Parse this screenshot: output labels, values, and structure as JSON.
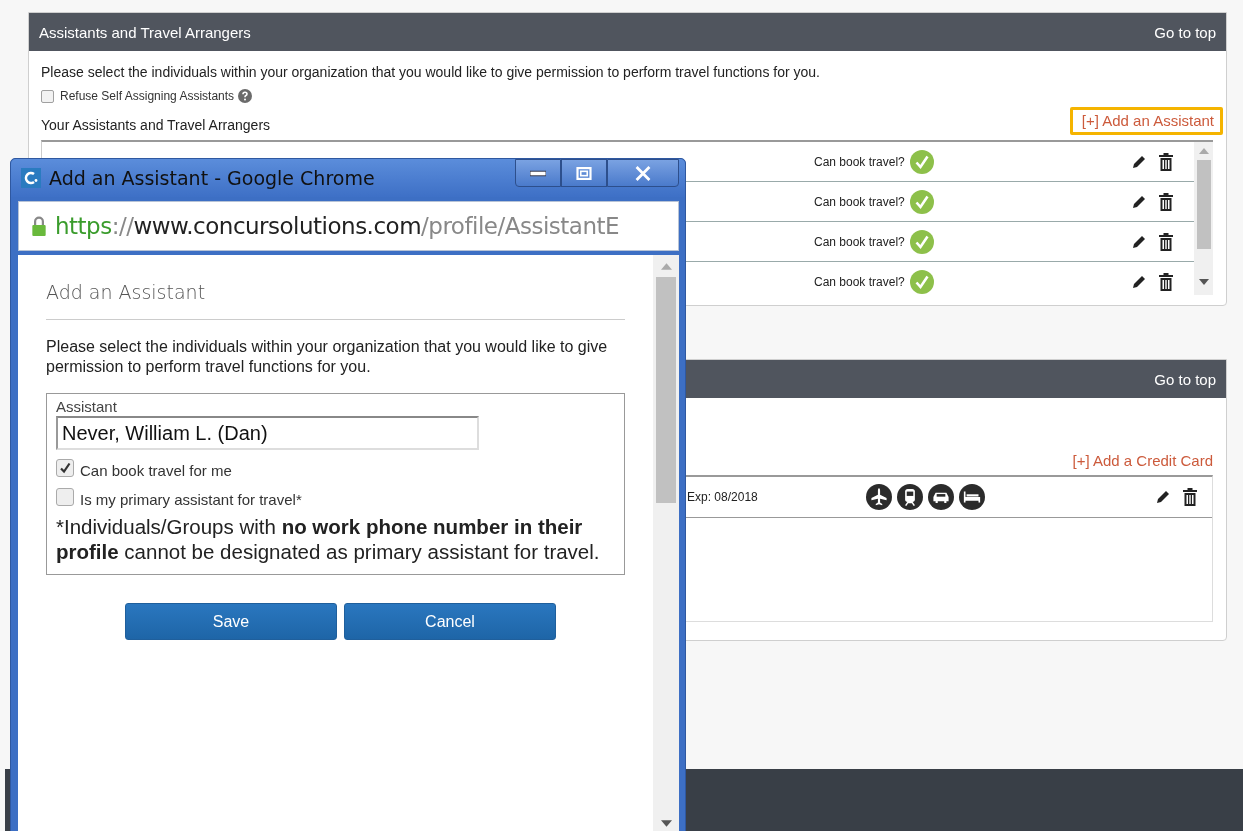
{
  "assistants_section": {
    "title": "Assistants and Travel Arrangers",
    "go_to_top": "Go to top",
    "intro": "Please select the individuals within your organization that you would like to give permission to perform travel functions for you.",
    "refuse_checkbox": {
      "label": "Refuse Self Assigning Assistants",
      "checked": false
    },
    "list_label": "Your Assistants and Travel Arrangers",
    "add_link": {
      "label": "[+] Add an Assistant",
      "highlighted": true
    },
    "rows": [
      {
        "permission": "Can book travel?",
        "can_book": true
      },
      {
        "permission": "Can book travel?",
        "can_book": true
      },
      {
        "permission": "Can book travel?",
        "can_book": true
      },
      {
        "permission": "Can book travel?",
        "can_book": true
      }
    ]
  },
  "credit_card_section": {
    "go_to_top": "Go to top",
    "add_link": "[+] Add a Credit Card",
    "cards": [
      {
        "expiry": "Exp: 08/2018"
      }
    ]
  },
  "popup": {
    "window_title": "Add an Assistant - Google Chrome",
    "url": [
      {
        "text": "https",
        "kind": "scheme"
      },
      {
        "text": "://",
        "kind": "sep"
      },
      {
        "text": "www.concursolutions.com",
        "kind": "host"
      },
      {
        "text": "/profile/AssistantE",
        "kind": "path"
      }
    ],
    "heading": "Add an Assistant",
    "intro": "Please select the individuals within your organization that you would like to give permission to perform travel functions for you.",
    "field_label": "Assistant",
    "field_value": "Never, William L. (Dan)",
    "options": [
      {
        "label": "Can book travel for me",
        "checked": true
      },
      {
        "label": "Is my primary assistant for travel*",
        "checked": false
      }
    ],
    "note": "*Individuals/Groups with **no work phone number in their profile** cannot be designated as primary assistant for travel.",
    "buttons": [
      "Save",
      "Cancel"
    ]
  }
}
